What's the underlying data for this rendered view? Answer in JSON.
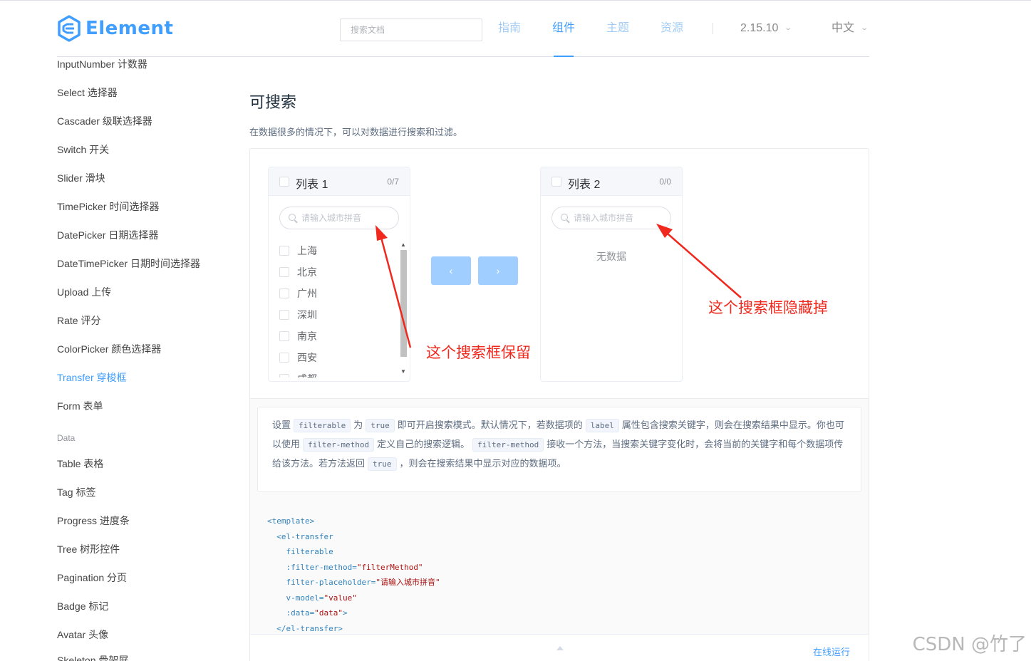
{
  "header": {
    "logo_text": "Element",
    "search_placeholder": "搜索文档",
    "nav": [
      {
        "label": "指南",
        "active": false
      },
      {
        "label": "组件",
        "active": true
      },
      {
        "label": "主题",
        "active": false
      },
      {
        "label": "资源",
        "active": false
      }
    ],
    "version": "2.15.10",
    "language": "中文"
  },
  "sidebar": {
    "items_top": [
      "InputNumber 计数器",
      "Select 选择器",
      "Cascader 级联选择器",
      "Switch 开关",
      "Slider 滑块",
      "TimePicker 时间选择器",
      "DatePicker 日期选择器",
      "DateTimePicker 日期时间选择器",
      "Upload 上传",
      "Rate 评分",
      "ColorPicker 颜色选择器",
      "Transfer 穿梭框",
      "Form 表单"
    ],
    "active_item": "Transfer 穿梭框",
    "group_label": "Data",
    "items_bottom": [
      "Table 表格",
      "Tag 标签",
      "Progress 进度条",
      "Tree 树形控件",
      "Pagination 分页",
      "Badge 标记",
      "Avatar 头像",
      "Skeleton 骨架屏"
    ]
  },
  "main": {
    "section_title": "可搜索",
    "section_desc": "在数据很多的情况下，可以对数据进行搜索和过滤。",
    "transfer": {
      "left": {
        "title": "列表 1",
        "count": "0/7",
        "filter_placeholder": "请输入城市拼音",
        "items": [
          "上海",
          "北京",
          "广州",
          "深圳",
          "南京",
          "西安",
          "成都"
        ]
      },
      "right": {
        "title": "列表 2",
        "count": "0/0",
        "filter_placeholder": "请输入城市拼音",
        "empty_text": "无数据"
      },
      "btn_left": "‹",
      "btn_right": "›"
    },
    "tip": {
      "t1": "设置",
      "c1": "filterable",
      "t2": "为",
      "c2": "true",
      "t3": "即可开启搜索模式。默认情况下，若数据项的",
      "c3": "label",
      "t4": "属性包含搜索关键字，则会在搜索结果中显示。你也可以使用",
      "c4": "filter-method",
      "t5": "定义自己的搜索逻辑。",
      "c5": "filter-method",
      "t6": "接收一个方法，当搜索关键字变化时，会将当前的关键字和每个数据项传给该方法。若方法返回",
      "c6": "true",
      "t7": "，则会在搜索结果中显示对应的数据项。"
    },
    "code": {
      "l1": "<template>",
      "l2": "  <el-transfer",
      "l3a": "    filterable",
      "l4a": "    :filter-method=",
      "l4b": "\"filterMethod\"",
      "l5a": "    filter-placeholder=",
      "l5b": "\"请输入城市拼音\"",
      "l6a": "    v-model=",
      "l6b": "\"value\"",
      "l7a": "    :data=",
      "l7b": "\"data\"",
      "l7c": ">",
      "l8": "  </el-transfer>"
    },
    "run_link": "在线运行"
  },
  "annotations": {
    "keep": "这个搜索框保留",
    "hide": "这个搜索框隐藏掉",
    "color": "#f0281e"
  },
  "watermark": "CSDN @竹了"
}
